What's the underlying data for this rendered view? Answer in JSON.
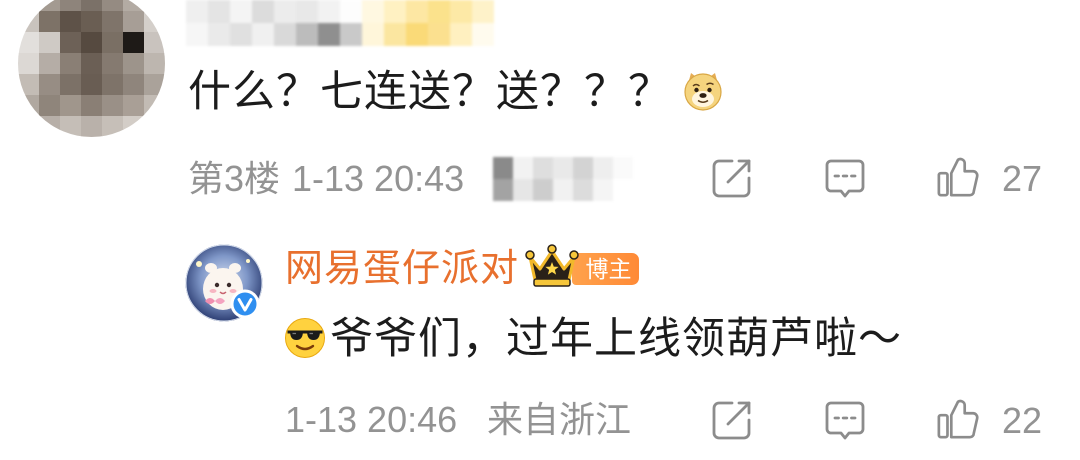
{
  "comment": {
    "text": "什么？七连送？送？？？",
    "emoji": "doge-emoji",
    "floor": "第3楼",
    "time": "1-13 20:43",
    "actions": {
      "share_icon": "share-icon",
      "reply_icon": "comment-icon",
      "like_icon": "thumb-up-icon",
      "like_count": "27"
    }
  },
  "reply": {
    "author": {
      "name": "网易蛋仔派对",
      "crown_icon": "crown-icon",
      "badge": "博主",
      "verified_icon": "verified-icon"
    },
    "emoji": "sunglasses-emoji",
    "text": "爷爷们，过年上线领葫芦啦～",
    "time": "1-13 20:46",
    "location": "来自浙江",
    "actions": {
      "share_icon": "share-icon",
      "reply_icon": "comment-icon",
      "like_icon": "thumb-up-icon",
      "like_count": "22"
    }
  },
  "colors": {
    "text": "#1c1c1c",
    "meta": "#939393",
    "icon": "#8c8c8c",
    "author_name": "#e8702e",
    "badge_bg": "#ff8a36",
    "badge_text": "#ffffff",
    "verified": "#2f8ff0"
  }
}
